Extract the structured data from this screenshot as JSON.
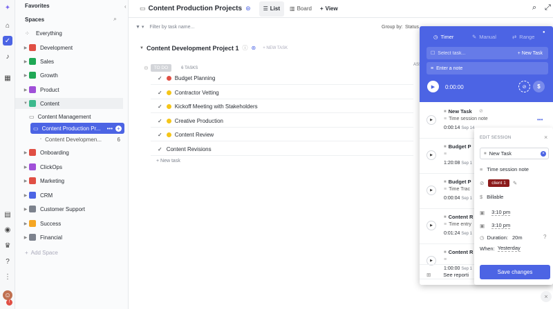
{
  "sidebar": {
    "favorites": "Favorites",
    "spaces": "Spaces",
    "everything": "Everything",
    "spaces_list": [
      {
        "label": "Development",
        "color": "#e04f44"
      },
      {
        "label": "Sales",
        "color": "#1fa855"
      },
      {
        "label": "Growth",
        "color": "#1fa855"
      },
      {
        "label": "Product",
        "color": "#a04fd8"
      },
      {
        "label": "Content",
        "color": "#3cb98d"
      }
    ],
    "content_folders": {
      "management": "Content Management",
      "production": "Content Production Pr...",
      "development": "Content Developmen...",
      "development_count": "6"
    },
    "more_spaces": [
      {
        "label": "Onboarding",
        "color": "#e04f44"
      },
      {
        "label": "ClickOps",
        "color": "#a04fd8"
      },
      {
        "label": "Marketing",
        "color": "#e04f44"
      },
      {
        "label": "CRM",
        "color": "#4c64e4"
      },
      {
        "label": "Customer Support",
        "color": "#7c828d"
      },
      {
        "label": "Success",
        "color": "#f5a623"
      },
      {
        "label": "Financial",
        "color": "#7c828d"
      }
    ],
    "add_space": "Add Space"
  },
  "topbar": {
    "title": "Content Production Projects",
    "list": "List",
    "board": "Board",
    "view": "View"
  },
  "filter": {
    "placeholder": "Filter by task name...",
    "group_by": "Group by:",
    "group_value": "Status"
  },
  "list": {
    "title": "Content Development Project 1",
    "new_task": "+ NEW TASK",
    "status": "TO DO",
    "count": "6 TASKS",
    "assignee": "ASS",
    "add_task": "+ New task",
    "tasks": [
      {
        "name": "Budget Planning",
        "dot": "#e04f44"
      },
      {
        "name": "Contractor Vetting",
        "dot": "#f5c518"
      },
      {
        "name": "Kickoff Meeting with Stakeholders",
        "dot": "#f5c518"
      },
      {
        "name": "Creative Production",
        "dot": "#f5c518"
      },
      {
        "name": "Content Review",
        "dot": "#f5c518"
      },
      {
        "name": "Content Revisions",
        "dot": ""
      }
    ]
  },
  "timer": {
    "tab_timer": "Timer",
    "tab_manual": "Manual",
    "tab_range": "Range",
    "select_task": "Select task...",
    "new_task": "+ New Task",
    "enter_note": "Enter a note",
    "time": "0:00:00",
    "see_report": "See reporti"
  },
  "entries": [
    {
      "task": "New Task",
      "note": "Time session note",
      "dur": "0:00:14",
      "date": "Sep 14"
    },
    {
      "task": "Budget P",
      "note": "",
      "dur": "1:20:08",
      "date": "Sep 1"
    },
    {
      "task": "Budget P",
      "note": "Time Trac",
      "dur": "0:00:04",
      "date": "Sep 1"
    },
    {
      "task": "Content R",
      "note": "Time entry",
      "dur": "0:01:24",
      "date": "Sep 1"
    },
    {
      "task": "Content R",
      "note": "",
      "dur": "1:00:00",
      "date": "Sep 1"
    }
  ],
  "edit": {
    "title": "EDIT SESSION",
    "task": "New Task",
    "note": "Time session note",
    "tag": "client 1",
    "billable": "Billable",
    "start": "3:10 pm",
    "end": "3:10 pm",
    "duration_label": "Duration:",
    "duration": "20m",
    "when_label": "When:",
    "when": "Yesterday",
    "save": "Save changes"
  }
}
